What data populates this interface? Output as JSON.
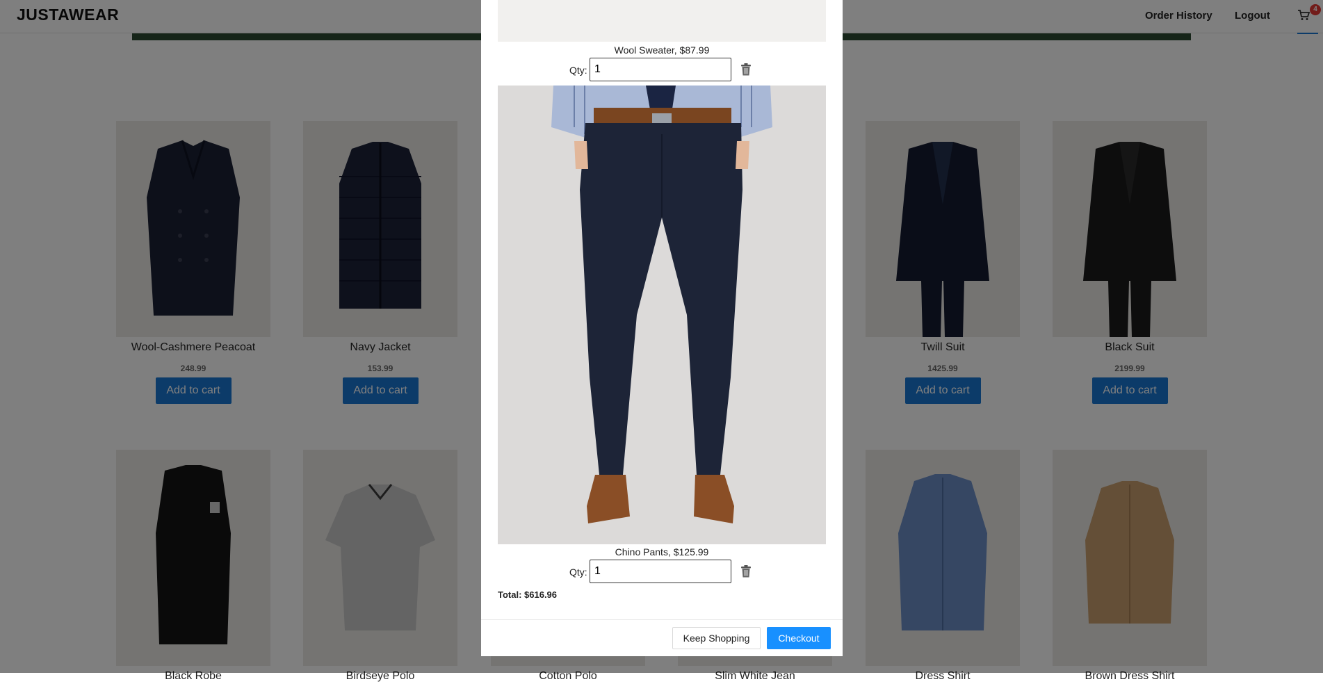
{
  "brand": "JUSTAWEAR",
  "nav": {
    "order_history": "Order History",
    "logout": "Logout",
    "cart_count": "4"
  },
  "colors": {
    "accent": "#1976d2",
    "checkout": "#1890ff",
    "badge": "#e53935",
    "banner": "#2d4a33"
  },
  "products": [
    {
      "name": "Wool-Cashmere Peacoat",
      "price": "248.99",
      "button": "Add to cart"
    },
    {
      "name": "Navy Jacket",
      "price": "153.99",
      "button": "Add to cart"
    },
    {
      "name": "Twill Suit",
      "price": "1425.99",
      "button": "Add to cart"
    },
    {
      "name": "Black Suit",
      "price": "2199.99",
      "button": "Add to cart"
    },
    {
      "name": "Black Robe",
      "price": "",
      "button": ""
    },
    {
      "name": "Birdseye Polo",
      "price": "",
      "button": ""
    },
    {
      "name": "Cotton Polo",
      "price": "",
      "button": ""
    },
    {
      "name": "Slim White Jean",
      "price": "",
      "button": ""
    },
    {
      "name": "Dress Shirt",
      "price": "",
      "button": ""
    },
    {
      "name": "Brown Dress Shirt",
      "price": "",
      "button": ""
    }
  ],
  "cart": {
    "items": [
      {
        "caption": "Wool Sweater, $87.99",
        "qty_label": "Qty:",
        "qty": "1"
      },
      {
        "caption": "Chino Pants, $125.99",
        "qty_label": "Qty:",
        "qty": "1"
      }
    ],
    "total": "Total: $616.96",
    "keep_shopping": "Keep Shopping",
    "checkout": "Checkout"
  },
  "icons": [
    "cart-icon",
    "trash-icon"
  ]
}
